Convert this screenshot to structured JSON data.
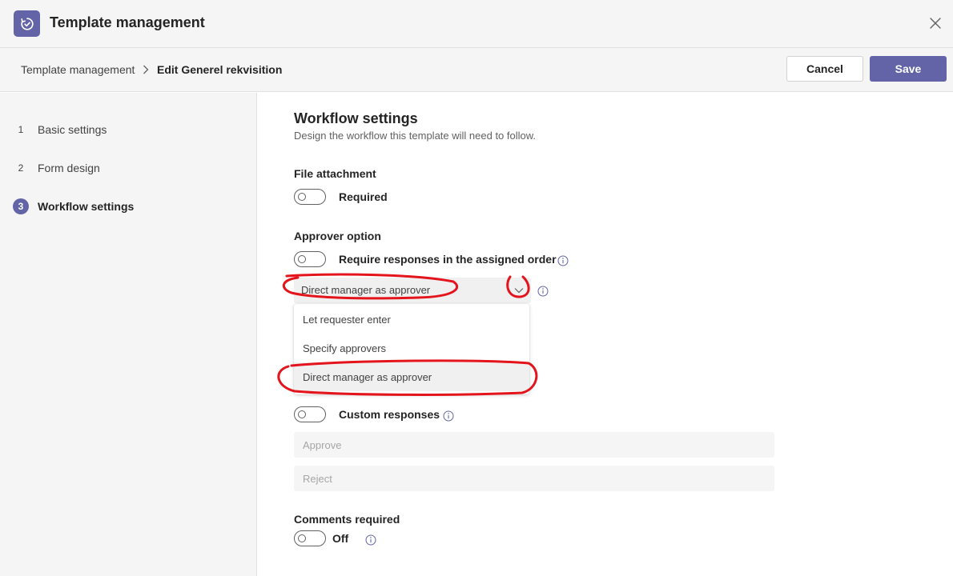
{
  "app": {
    "title": "Template management",
    "icon": "approvals-icon",
    "close_icon": "close-icon"
  },
  "breadcrumb": {
    "parent": "Template management",
    "current": "Edit Generel rekvisition"
  },
  "toolbar": {
    "cancel_label": "Cancel",
    "save_label": "Save"
  },
  "steps": [
    {
      "number": "1",
      "label": "Basic settings",
      "active": false
    },
    {
      "number": "2",
      "label": "Form design",
      "active": false
    },
    {
      "number": "3",
      "label": "Workflow settings",
      "active": true
    }
  ],
  "workflow": {
    "title": "Workflow settings",
    "subtitle": "Design the workflow this template will need to follow.",
    "file_attachment": {
      "label": "File attachment",
      "toggle_label": "Required",
      "on": false
    },
    "approver_option": {
      "label": "Approver option",
      "toggle_label": "Require responses in the assigned order",
      "on": false,
      "selected": "Direct manager as approver",
      "options": [
        "Let requester enter",
        "Specify approvers",
        "Direct manager as approver"
      ]
    },
    "responses": {
      "toggle_label": "Custom responses",
      "on": false,
      "approve_placeholder": "Approve",
      "reject_placeholder": "Reject"
    },
    "comments": {
      "label": "Comments required",
      "toggle_label": "Off",
      "on": false
    }
  },
  "colors": {
    "brand": "#6264a7",
    "annotation": "#e3141b",
    "sidebar_bg": "#f5f5f5"
  }
}
